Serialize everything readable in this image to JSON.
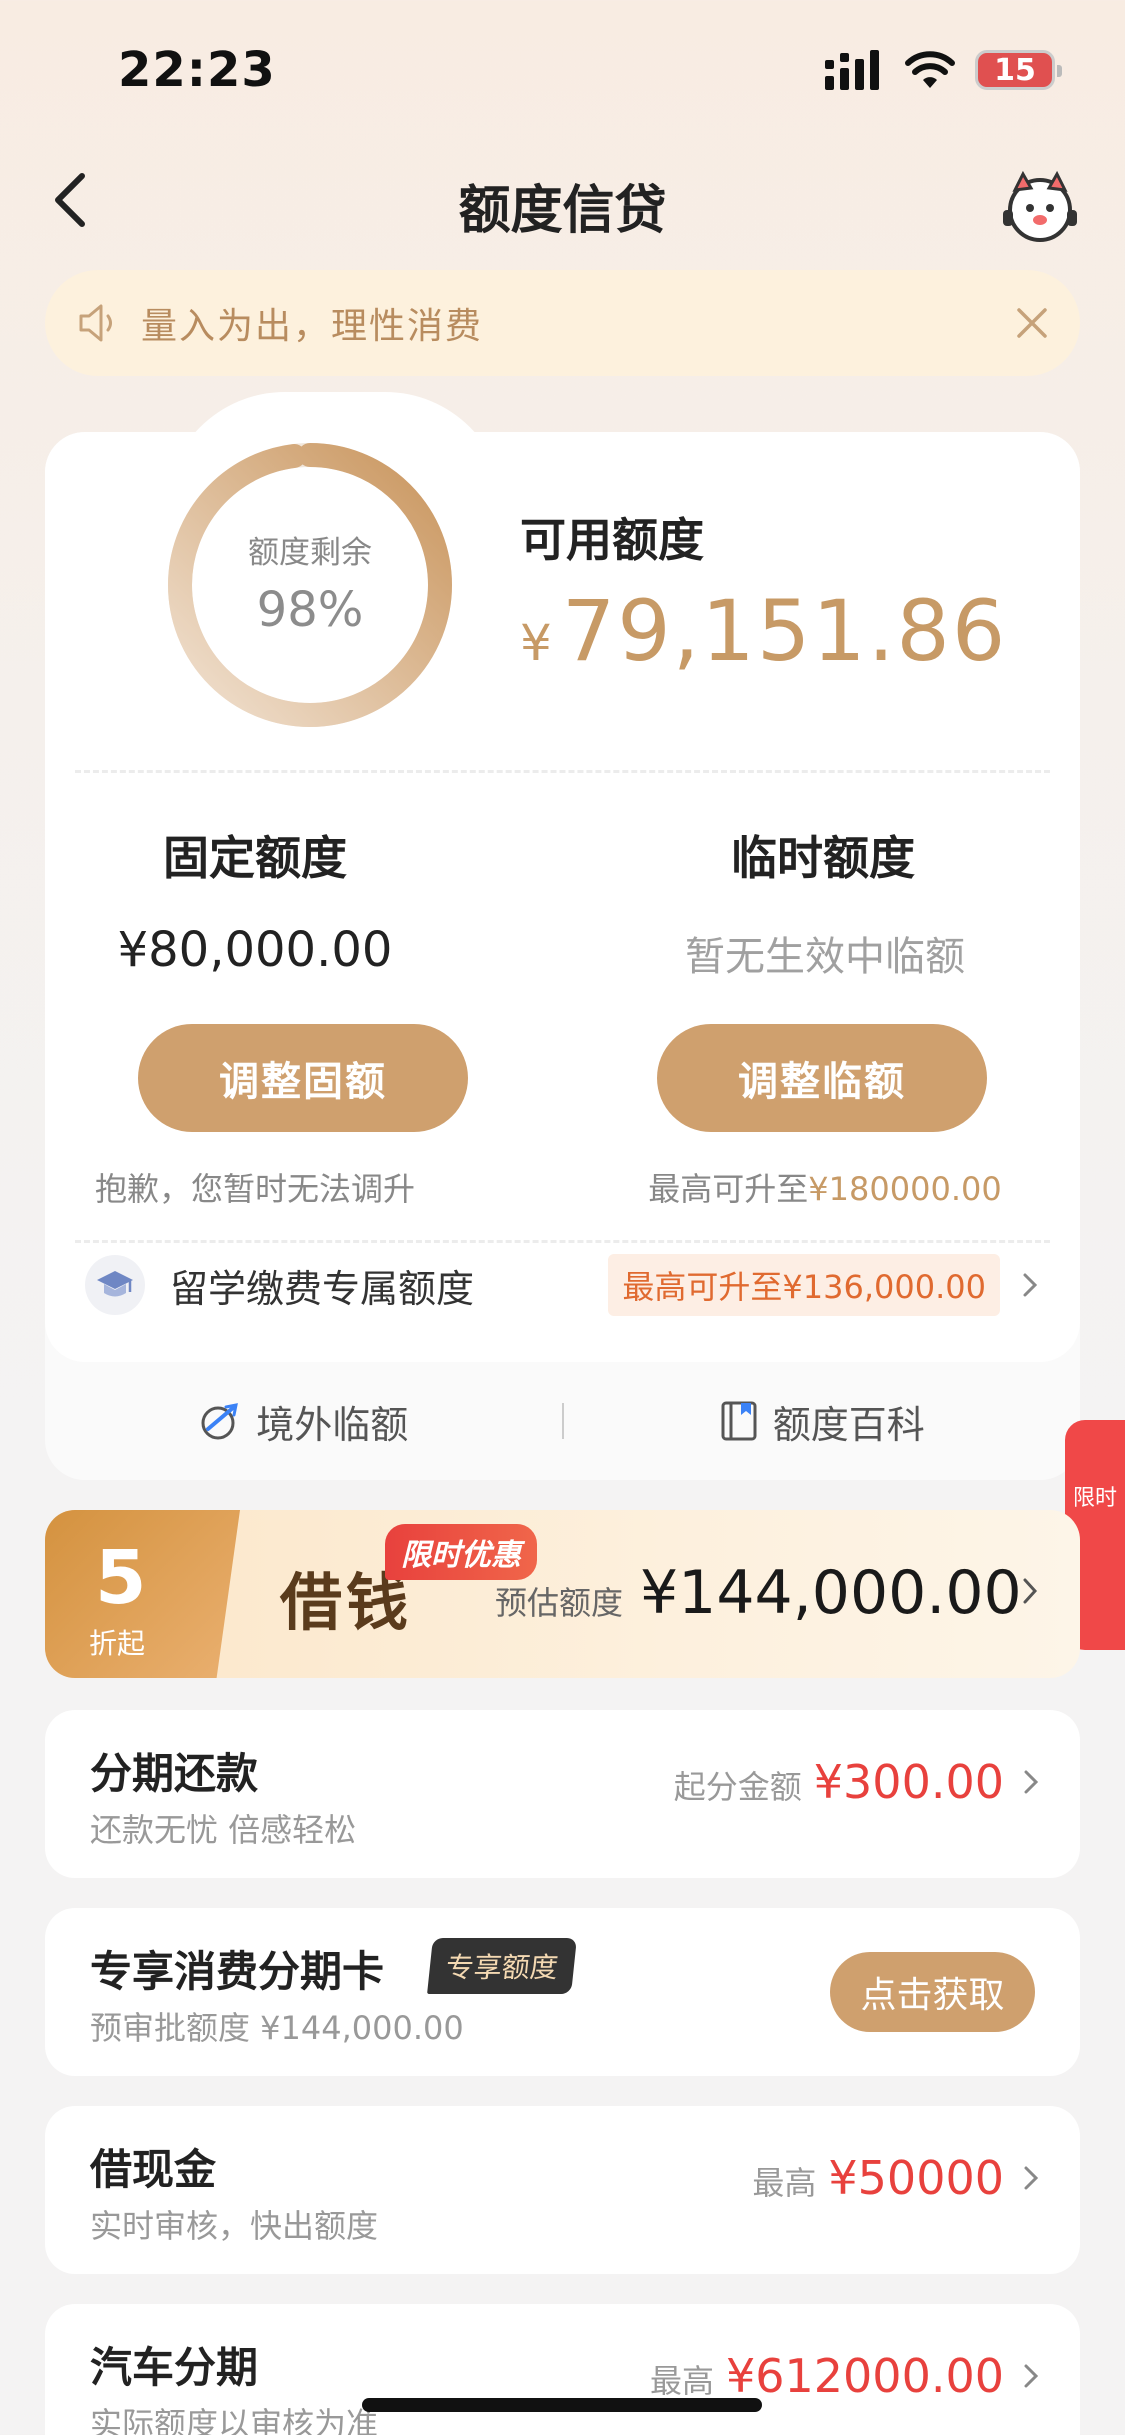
{
  "status": {
    "time": "22:23",
    "battery": "15"
  },
  "nav": {
    "title": "额度信贷"
  },
  "notice": {
    "text": "量入为出，理性消费"
  },
  "credit": {
    "remain_label": "额度剩余",
    "remain_percent": "98%",
    "remain_fraction": 0.98,
    "available_label": "可用额度",
    "available_currency": "¥",
    "available_amount": "79,151.86",
    "fixed": {
      "title": "固定额度",
      "value": "¥80,000.00",
      "button": "调整固额",
      "note": "抱歉，您暂时无法调升"
    },
    "temp": {
      "title": "临时额度",
      "value": "暂无生效中临额",
      "button": "调整临额",
      "note_prefix": "最高可升至",
      "note_value": "¥180000.00"
    },
    "study": {
      "label": "留学缴费专属额度",
      "tag": "最高可升至¥136,000.00"
    },
    "links": [
      {
        "label": "境外临额"
      },
      {
        "label": "额度百科"
      }
    ]
  },
  "side_float": {
    "text": "限时"
  },
  "loan": {
    "discount_num": "5",
    "discount_sub": "折起",
    "title": "借钱",
    "badge": "限时优惠",
    "est_label": "预估额度",
    "est_value": "¥144,000.00"
  },
  "items": [
    {
      "title": "分期还款",
      "sub": "还款无忧 倍感轻松",
      "right_label": "起分金额",
      "right_value": "¥300.00"
    },
    {
      "title": "专享消费分期卡",
      "tag": "专享额度",
      "sub": "预审批额度 ¥144,000.00",
      "button": "点击获取"
    },
    {
      "title": "借现金",
      "sub": "实时审核，快出额度",
      "right_label": "最高",
      "right_value": "¥50000"
    },
    {
      "title": "汽车分期",
      "sub": "实际额度以审核为准",
      "right_label": "最高",
      "right_value": "¥612000.00"
    }
  ],
  "colors": {
    "accent": "#cfa06e",
    "amount": "#c79a66",
    "red": "#e8413d"
  }
}
